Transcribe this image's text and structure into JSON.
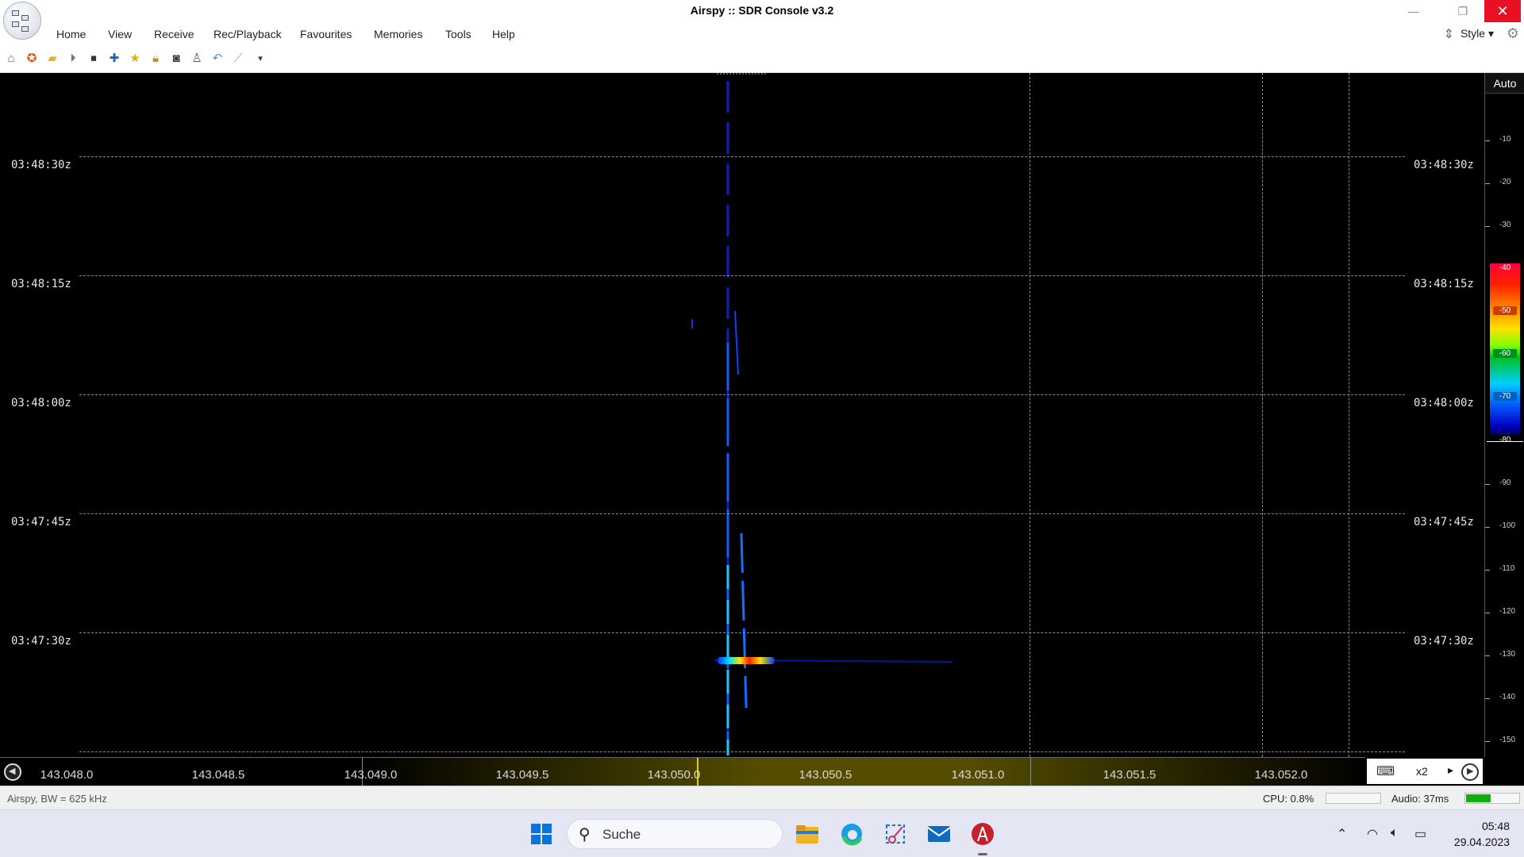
{
  "window": {
    "title": "Airspy :: SDR Console v3.2",
    "minimize_glyph": "—",
    "restore_glyph": "❐",
    "close_glyph": "✕"
  },
  "menu": {
    "items": [
      "Home",
      "View",
      "Receive",
      "Rec/Playback",
      "Favourites",
      "Memories",
      "Tools",
      "Help"
    ],
    "style_label": "Style"
  },
  "toolbar": {
    "icons": [
      "home-icon",
      "lifebuoy-icon",
      "folder-icon",
      "play-icon",
      "stop-icon",
      "add-icon",
      "favourite-star-icon",
      "lock-icon",
      "camera-icon",
      "satellite-icon",
      "undo-icon",
      "chart-icon",
      "overflow-chevron-icon"
    ]
  },
  "waterfall": {
    "time_labels": [
      "03:48:30z",
      "03:48:15z",
      "03:48:00z",
      "03:47:45z",
      "03:47:30z"
    ],
    "scale": {
      "auto_label": "Auto",
      "ticks": [
        "-10",
        "-20",
        "-30",
        "-40",
        "-50",
        "-60",
        "-70",
        "-80",
        "-90",
        "-100",
        "-110",
        "-120",
        "-130",
        "-140",
        "-150"
      ],
      "colorbar_labels": [
        "-40",
        "-50",
        "-60",
        "-70"
      ],
      "colorbar_range_db": [
        -40,
        -80
      ]
    }
  },
  "frequency_axis": {
    "labels": [
      "143.048.0",
      "143.048.5",
      "143.049.0",
      "143.049.5",
      "143.050.0",
      "143.050.5",
      "143.051.0",
      "143.051.5",
      "143.052.0"
    ],
    "zoom_label": "x2"
  },
  "status": {
    "left_text": "Airspy, BW = 625 kHz",
    "cpu_text": "CPU: 0.8%",
    "cpu_level": 0.008,
    "audio_text": "Audio: 37ms",
    "audio_level": 0.45
  },
  "taskbar": {
    "search_placeholder": "Suche",
    "apps": [
      "windows-start-icon",
      "file-explorer-icon",
      "edge-browser-icon",
      "snipping-tool-icon",
      "mail-icon",
      "sdr-console-icon"
    ],
    "clock_time": "05:48",
    "clock_date": "29.04.2023"
  }
}
